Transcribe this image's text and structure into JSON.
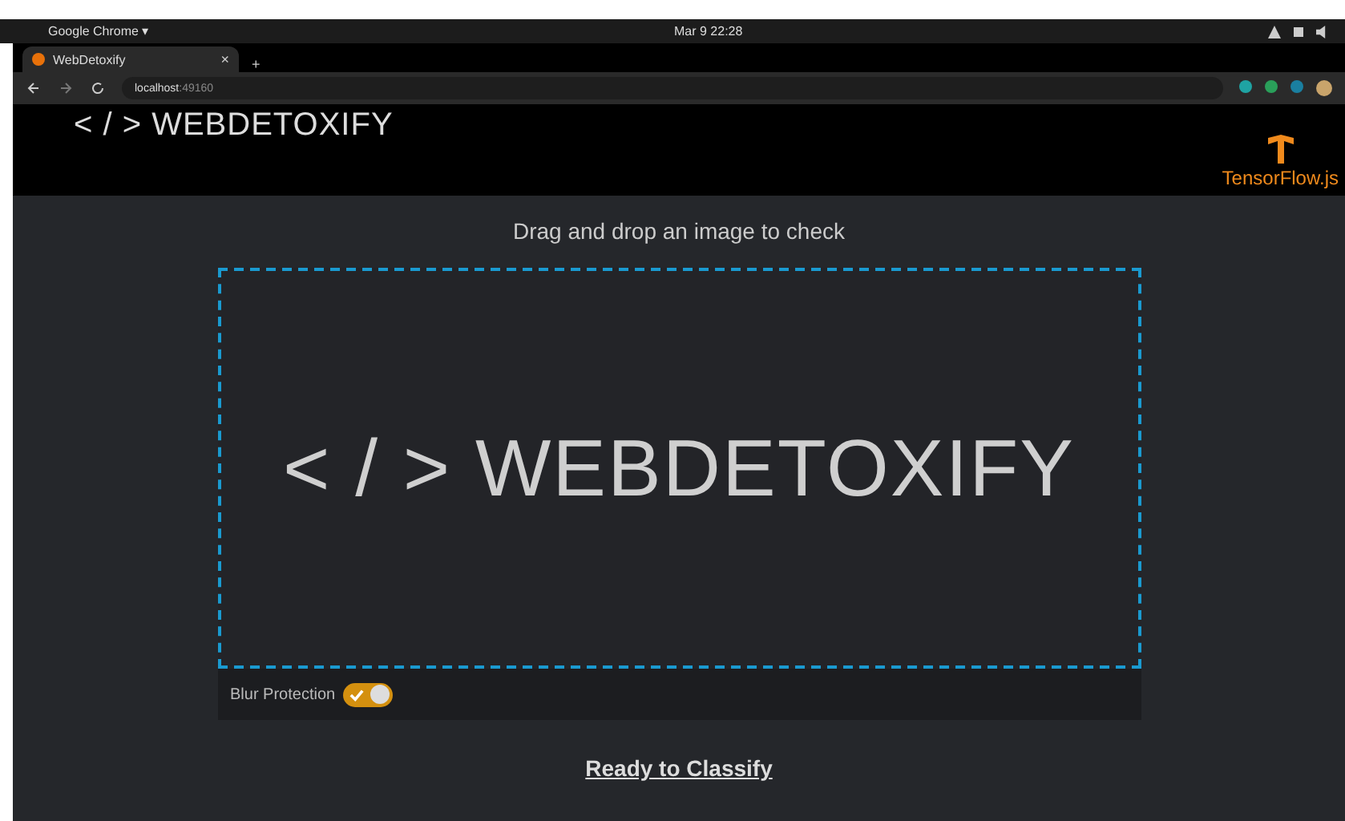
{
  "desktop_bar": {
    "app": "Google Chrome ▾",
    "clock": "Mar 9  22:28"
  },
  "browser": {
    "tab": {
      "title": "WebDetoxify",
      "close": "×"
    },
    "new_tab": "+",
    "url_host": "localhost",
    "url_port": ":49160"
  },
  "header": {
    "logo": "< / > WEBDETOXIFY",
    "tf_label": "TensorFlow.js"
  },
  "dropzone": {
    "prompt": "Drag and drop an image to check",
    "image_text": "< / > WEBDETOXIFY"
  },
  "blur_protection": {
    "label": "Blur Protection",
    "on": true
  },
  "status": "Ready to Classify"
}
